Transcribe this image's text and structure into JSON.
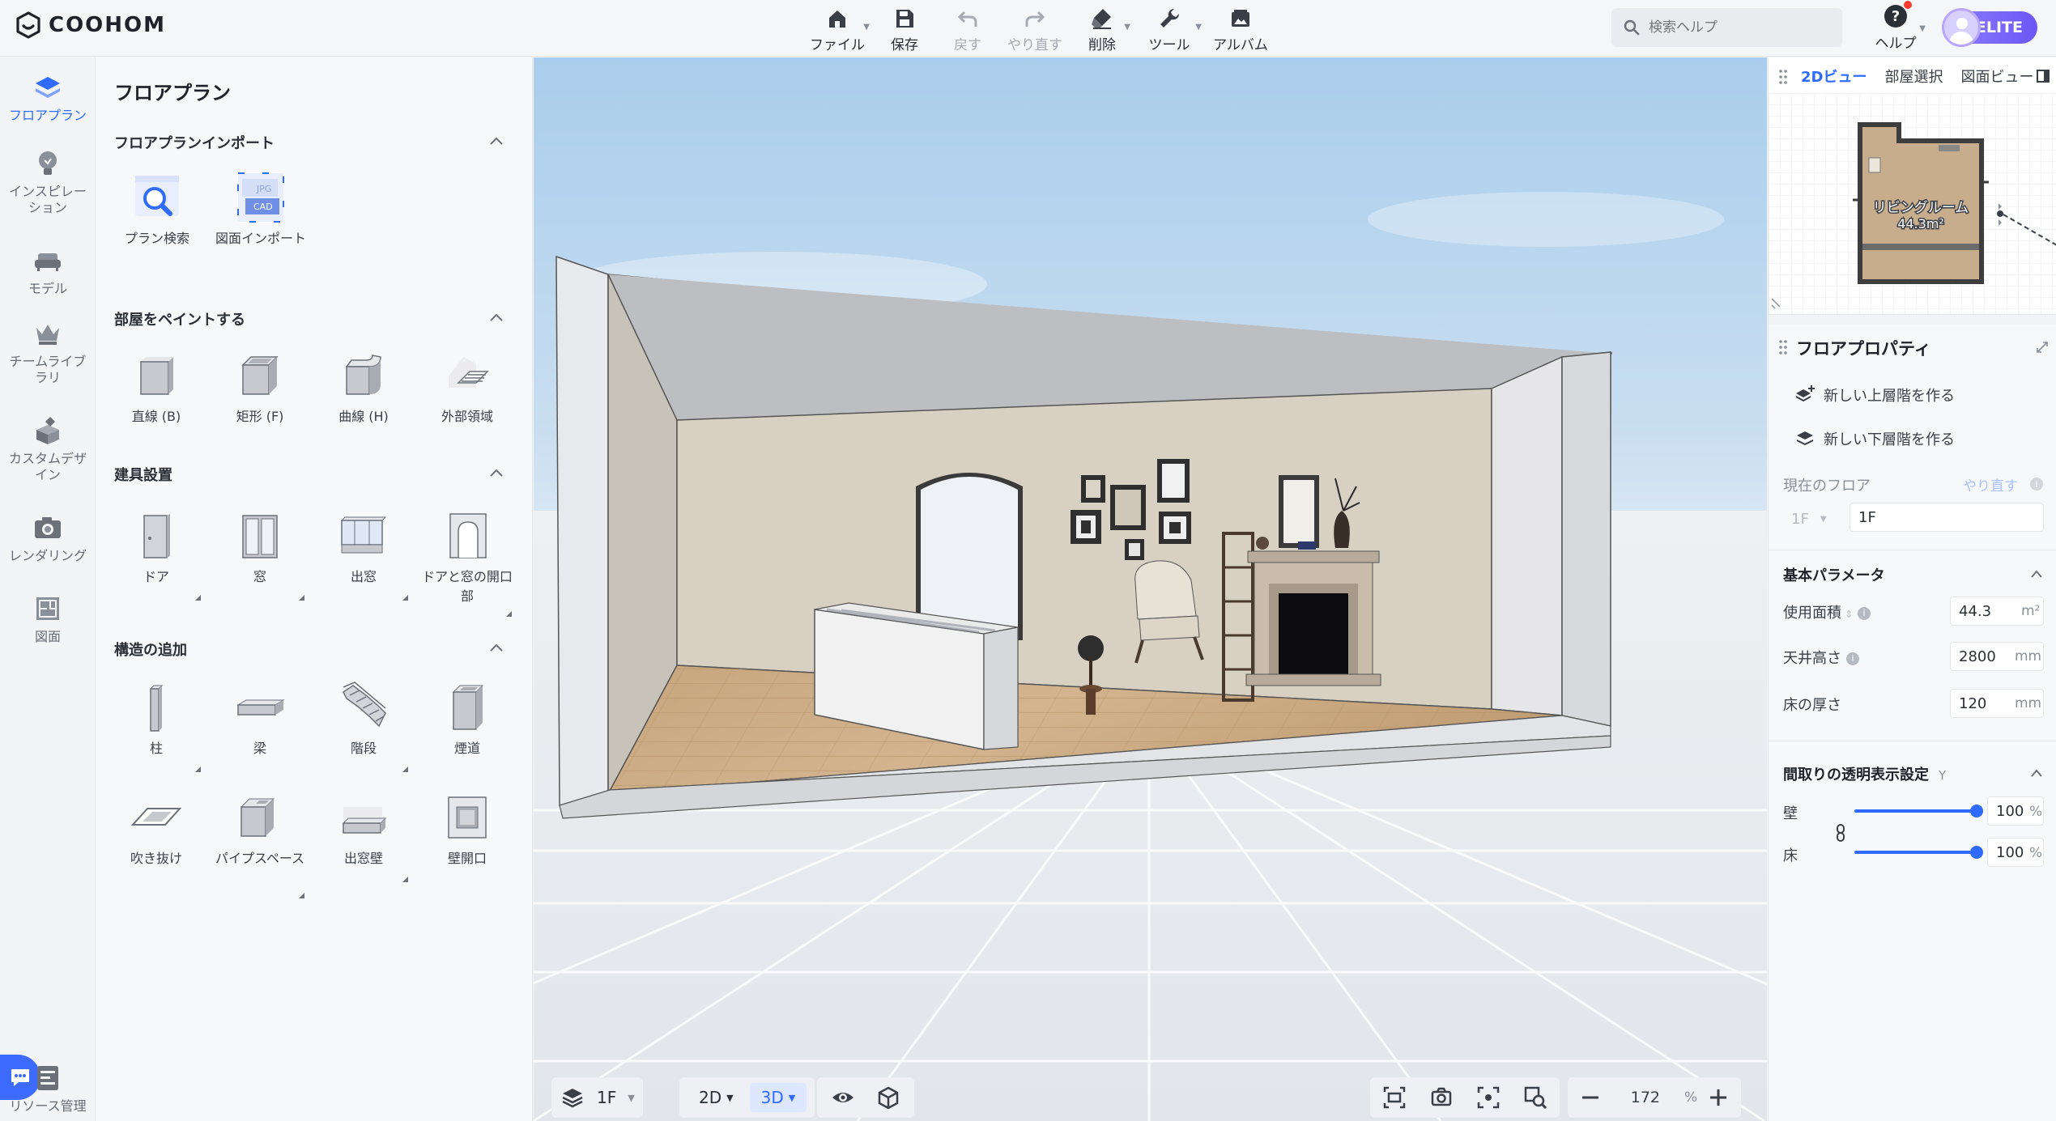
{
  "app": {
    "logo": "COOHOM"
  },
  "toolbar": {
    "items": [
      {
        "label": "ファイル",
        "icon": "home-icon",
        "caret": true
      },
      {
        "label": "保存",
        "icon": "save-icon"
      },
      {
        "label": "戻す",
        "icon": "undo-icon",
        "disabled": true
      },
      {
        "label": "やり直す",
        "icon": "redo-icon",
        "disabled": true
      },
      {
        "label": "削除",
        "icon": "eraser-icon",
        "caret": true
      },
      {
        "label": "ツール",
        "icon": "wrench-icon",
        "caret": true
      },
      {
        "label": "アルバム",
        "icon": "album-icon"
      }
    ]
  },
  "search": {
    "placeholder": "検索ヘルプ"
  },
  "help": {
    "label": "ヘルプ"
  },
  "account": {
    "badge": "ELITE"
  },
  "rail": {
    "items": [
      {
        "label": "フロアプラン",
        "active": true
      },
      {
        "label": "インスピレーション"
      },
      {
        "label": "モデル"
      },
      {
        "label": "チームライブラリ"
      },
      {
        "label": "カスタムデザイン"
      },
      {
        "label": "レンダリング"
      },
      {
        "label": "図面"
      }
    ],
    "resource": "リソース管理"
  },
  "panel": {
    "title": "フロアプラン",
    "sections": [
      {
        "title": "フロアプランインポート",
        "tools": [
          "プラン検索",
          "図面インポート"
        ]
      },
      {
        "title": "部屋をペイントする",
        "tools": [
          "直線 (B)",
          "矩形 (F)",
          "曲線 (H)",
          "外部領域"
        ]
      },
      {
        "title": "建具設置",
        "tools": [
          "ドア",
          "窓",
          "出窓",
          "ドアと窓の開口部"
        ]
      },
      {
        "title": "構造の追加",
        "tools": [
          "柱",
          "梁",
          "階段",
          "煙道",
          "吹き抜け",
          "パイプスペース",
          "出窓壁",
          "壁開口"
        ]
      }
    ],
    "import_badges": {
      "jpg": "JPG",
      "cad": "CAD"
    }
  },
  "viewport": {
    "floor": "1F",
    "view_2d": "2D",
    "view_3d": "3D",
    "zoom": "172",
    "zoom_unit": "%"
  },
  "minimap": {
    "tabs": [
      "2Dビュー",
      "部屋選択",
      "図面ビュー"
    ],
    "room_name": "リビングルーム",
    "room_area": "44.3m²"
  },
  "props": {
    "title": "フロアプロパティ",
    "add_upper": "新しい上層階を作る",
    "add_lower": "新しい下層階を作る",
    "current_floor_label": "現在のフロア",
    "redo_link": "やり直す",
    "floor_select": "1F",
    "floor_name": "1F",
    "basic_title": "基本パラメータ",
    "area_label": "使用面積",
    "area_value": "44.3",
    "area_unit": "m²",
    "ceiling_label": "天井高さ",
    "ceiling_value": "2800",
    "ceiling_unit": "mm",
    "floor_thick_label": "床の厚さ",
    "floor_thick_value": "120",
    "floor_thick_unit": "mm",
    "transparency_title": "間取りの透明表示設定",
    "wall_label": "壁",
    "wall_value": "100",
    "floor_label": "床",
    "floor_value": "100",
    "percent": "%"
  },
  "colors": {
    "accent": "#2f6bff",
    "elite": "#7b68ff",
    "chat": "#3d6bff"
  }
}
